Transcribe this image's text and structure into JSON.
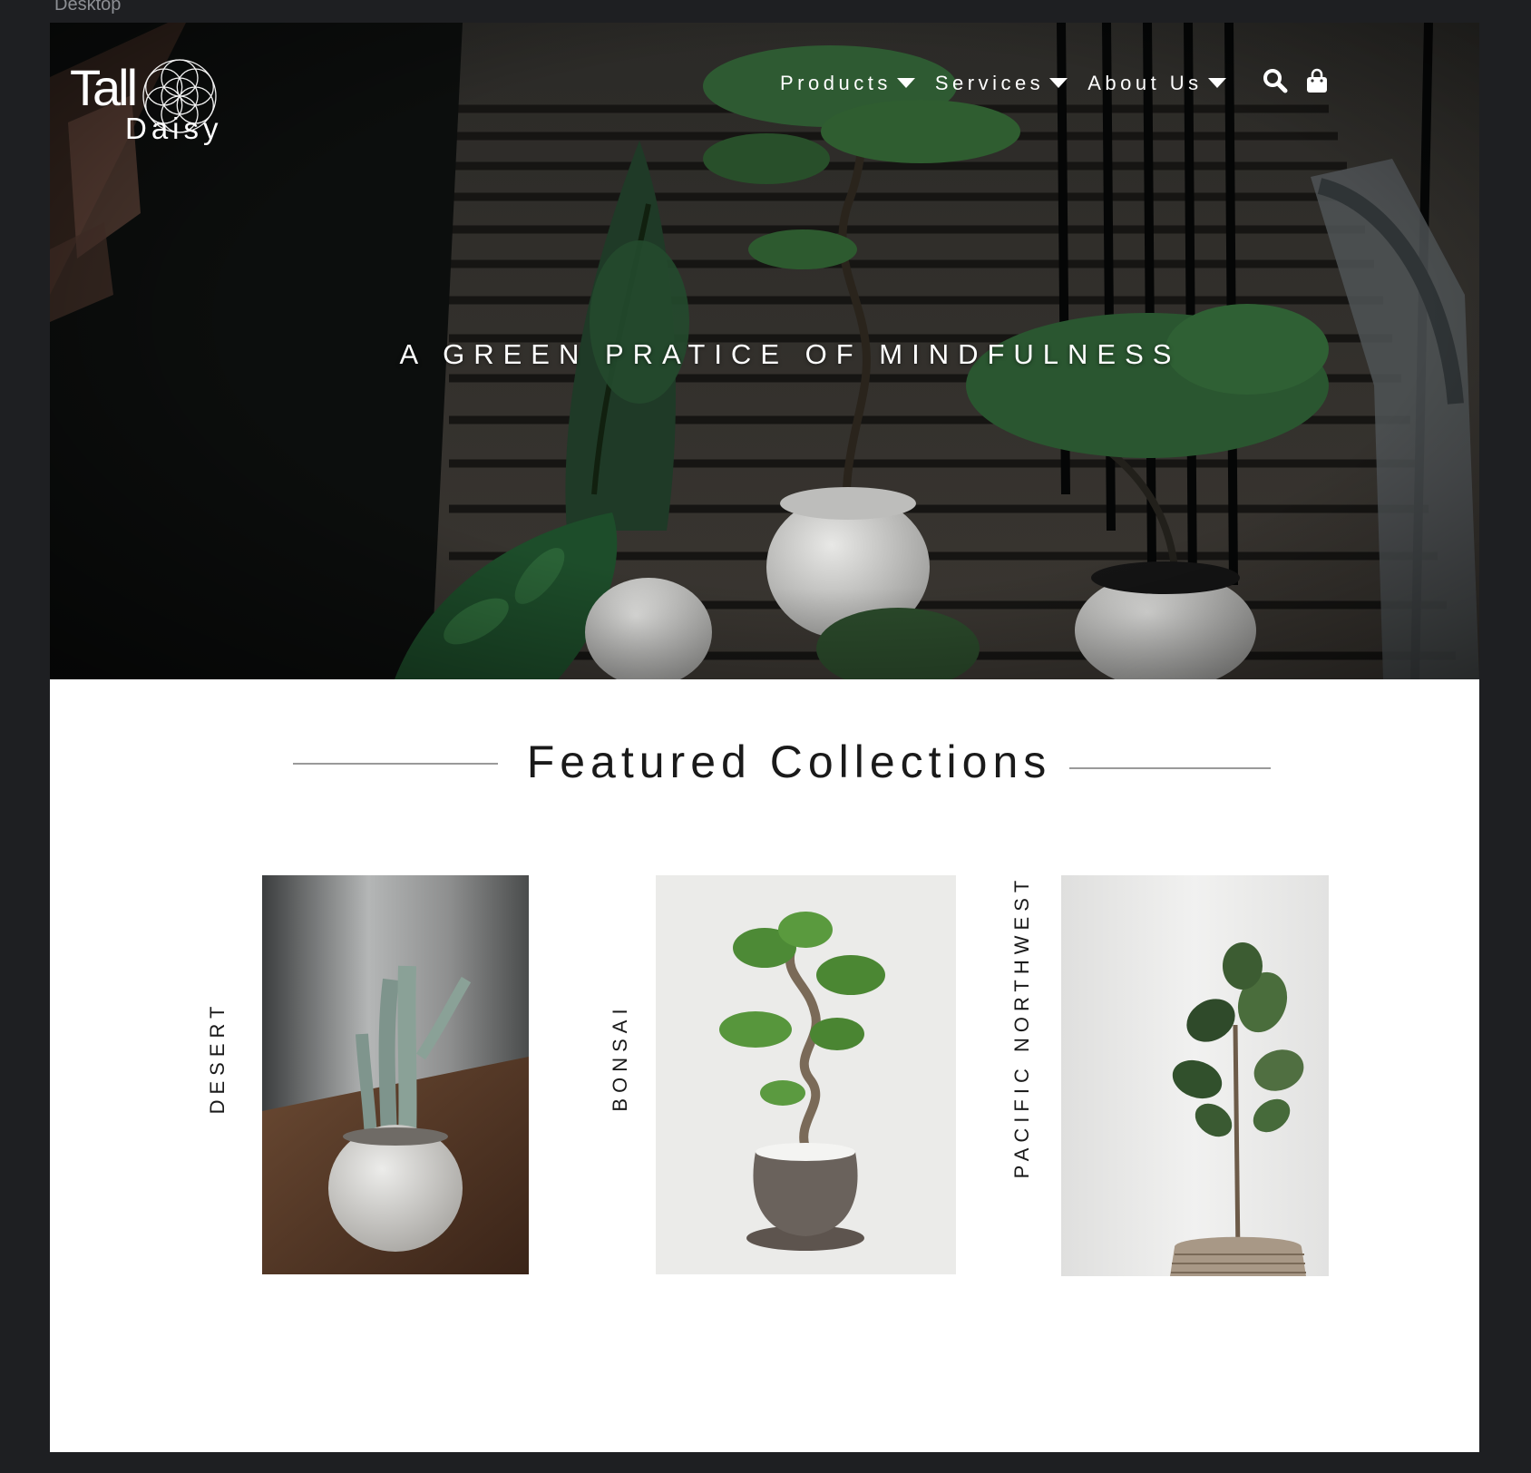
{
  "canvas": {
    "frame_label": "Desktop"
  },
  "brand": {
    "logo_line1": "Tall",
    "logo_line2": "Daisy"
  },
  "nav": {
    "items": [
      {
        "label": "Products"
      },
      {
        "label": "Services"
      },
      {
        "label": "About Us"
      }
    ],
    "search_icon": "search-icon",
    "cart_icon": "shopping-bag-icon"
  },
  "hero": {
    "tagline": "A GREEN PRATICE OF MINDFULNESS"
  },
  "featured": {
    "title": "Featured Collections",
    "collections": [
      {
        "label": "DESERT",
        "image": "cactus in white pot"
      },
      {
        "label": "BONSAI",
        "image": "bonsai in grey pot"
      },
      {
        "label": "PACIFIC NORTHWEST",
        "image": "fiddle leaf fig in basket"
      }
    ]
  },
  "colors": {
    "page_bg": "#1e1f22",
    "artboard_bg": "#ffffff",
    "text_dark": "#1a1a1a",
    "hero_text": "#ffffff",
    "rule": "#9a9a9a"
  }
}
